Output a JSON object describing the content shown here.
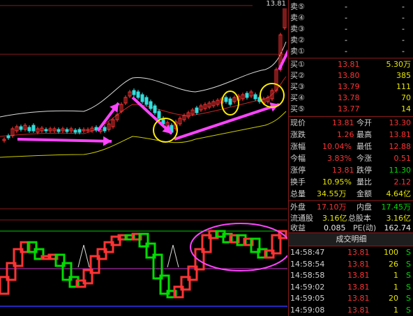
{
  "chart": {
    "top_price_label": "13.81"
  },
  "asks": [
    {
      "label": "卖⑤",
      "price": "-",
      "vol": "-"
    },
    {
      "label": "卖④",
      "price": "-",
      "vol": "-"
    },
    {
      "label": "卖③",
      "price": "-",
      "vol": "-"
    },
    {
      "label": "卖②",
      "price": "-",
      "vol": "-"
    },
    {
      "label": "卖①",
      "price": "-",
      "vol": "-"
    }
  ],
  "bids": [
    {
      "label": "买①",
      "price": "13.81",
      "vol": "5.30万"
    },
    {
      "label": "买②",
      "price": "13.80",
      "vol": "385"
    },
    {
      "label": "买③",
      "price": "13.79",
      "vol": "111"
    },
    {
      "label": "买④",
      "price": "13.78",
      "vol": "70"
    },
    {
      "label": "买⑤",
      "price": "13.77",
      "vol": "14"
    }
  ],
  "quote": {
    "now_label": "现价",
    "now": "13.81",
    "open_label": "今开",
    "open": "13.30",
    "chg_label": "涨跌",
    "chg": "1.26",
    "high_label": "最高",
    "high": "13.81",
    "pct_label": "涨幅",
    "pct": "10.04%",
    "low_label": "最低",
    "low": "12.88",
    "amp_label": "今幅",
    "amp": "3.83%",
    "rise_label": "今涨",
    "rise": "0.51",
    "limit_up_label": "涨停",
    "limit_up": "13.81",
    "limit_down_label": "跌停",
    "limit_down": "11.30",
    "turnover_label": "换手",
    "turnover": "10.95%",
    "ratio_label": "量比",
    "ratio": "2.12",
    "volume_label": "总量",
    "volume": "34.55万",
    "amount_label": "金额",
    "amount": "4.64亿",
    "outer_label": "外盘",
    "outer": "17.10万",
    "inner_label": "内盘",
    "inner": "17.45万",
    "float_label": "流通股",
    "float": "3.16亿",
    "total_label": "总股本",
    "total": "3.16亿",
    "eps_label": "收益",
    "eps": "0.085",
    "pe_label": "PE(动)",
    "pe": "162.74"
  },
  "trades": {
    "title": "成交明细",
    "rows": [
      {
        "time": "14:58:47",
        "price": "13.81",
        "vol": "100",
        "side": "S"
      },
      {
        "time": "14:58:54",
        "price": "13.81",
        "vol": "26",
        "side": "S"
      },
      {
        "time": "14:58:58",
        "price": "13.81",
        "vol": "1",
        "side": "S"
      },
      {
        "time": "14:59:02",
        "price": "13.81",
        "vol": "1",
        "side": "S"
      },
      {
        "time": "14:59:05",
        "price": "13.81",
        "vol": "20",
        "side": "S"
      },
      {
        "time": "14:59:08",
        "price": "13.81",
        "vol": "1",
        "side": "S"
      }
    ]
  },
  "colors": {
    "up": "#ff3333",
    "down": "#00dd00",
    "grid": "#8a1a1a",
    "annotation": "#ff44ff",
    "highlight": "#ffee00"
  }
}
